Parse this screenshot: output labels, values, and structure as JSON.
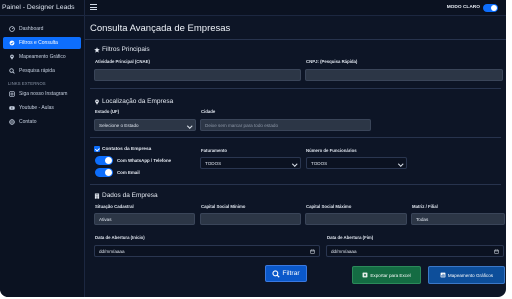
{
  "app": {
    "brand": "Painel - Designer Leads"
  },
  "sidebar": {
    "items": [
      {
        "label": "Dashboard",
        "icon": "dashboard-icon"
      },
      {
        "label": "Filtros e Consulta",
        "icon": "filter-icon",
        "active": true
      },
      {
        "label": "Mapeamento Gráfico",
        "icon": "map-icon"
      },
      {
        "label": "Pesquisa rápida",
        "icon": "search-icon"
      }
    ],
    "external_title": "LINKS EXTERNOS",
    "external_items": [
      {
        "label": "Siga nosso Instagram",
        "icon": "instagram-icon"
      },
      {
        "label": "Youtube - Aulas",
        "icon": "youtube-icon"
      },
      {
        "label": "Contato",
        "icon": "globe-icon"
      }
    ]
  },
  "topbar": {
    "mode_label": "MODO CLARO",
    "mode_on": true
  },
  "main": {
    "title": "Consulta Avançada de Empresas",
    "principais": {
      "title": "Filtros Principais",
      "cnae_label": "Atividade Principal (CNAE)",
      "cnae_value": "",
      "cnpj_label": "CNPJ: (Pesquisa Rápida)",
      "cnpj_value": ""
    },
    "localizacao": {
      "title": "Localização da Empresa",
      "estado_label": "Estado (UF)",
      "estado_value": "Selecione o Estado",
      "cidade_label": "Cidade",
      "cidade_placeholder": "Deixe sem marcar para todo estado"
    },
    "contatos": {
      "title": "Contatos da Empresa",
      "whatsapp_label": "Com WhatsApp / Telefone",
      "email_label": "Com Email",
      "faturamento_label": "Faturamento",
      "faturamento_value": "TODOS",
      "funcionarios_label": "Número de Funcionários",
      "funcionarios_value": "TODOS"
    },
    "dados": {
      "title": "Dados da Empresa",
      "situacao_label": "Situação Cadastral",
      "situacao_value": "Ativas",
      "cap_min_label": "Capital Social Mínimo",
      "cap_min_value": "",
      "cap_max_label": "Capital Social Máximo",
      "cap_max_value": "",
      "matriz_label": "Matriz / Filial",
      "matriz_value": "Todas",
      "abertura_inicio_label": "Data de Abertura (Início)",
      "abertura_inicio_value": "dd/mm/aaaa",
      "abertura_fim_label": "Data de Abertura (Fim)",
      "abertura_fim_value": "dd/mm/aaaa"
    },
    "actions": {
      "filtrar": "Filtrar",
      "exportar": "Exportar para Excel",
      "mapeamento": "Mapeamento Gráficos"
    }
  },
  "colors": {
    "primary": "#0d6efd",
    "success": "#146c43",
    "background": "#0d1526"
  }
}
